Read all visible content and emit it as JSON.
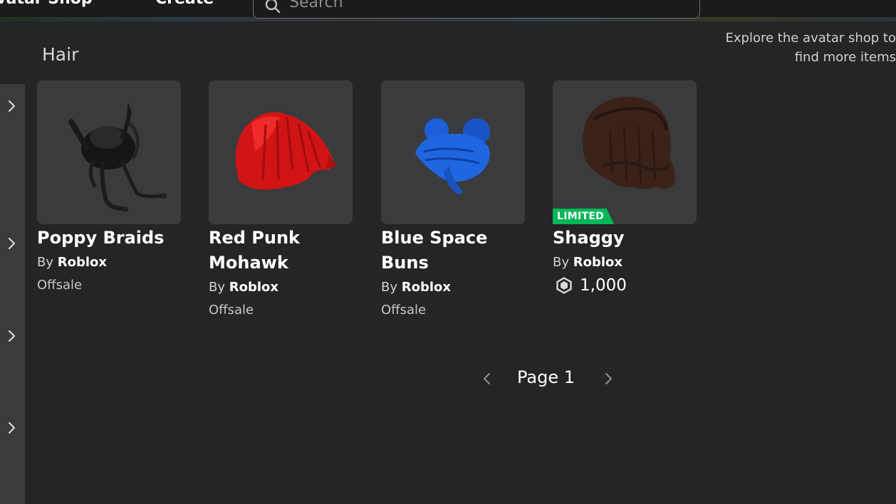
{
  "nav": {
    "avatar_shop": "Avatar Shop",
    "create": "Create",
    "search_placeholder": "Search"
  },
  "section": {
    "title": "Hair",
    "explore_line1": "Explore the avatar shop to",
    "explore_line2": "find more items"
  },
  "items": [
    {
      "name": "Poppy Braids",
      "by": "By",
      "creator": "Roblox",
      "status": "Offsale",
      "limited": false
    },
    {
      "name": "Red Punk Mohawk",
      "by": "By",
      "creator": "Roblox",
      "status": "Offsale",
      "limited": false
    },
    {
      "name": "Blue Space Buns",
      "by": "By",
      "creator": "Roblox",
      "status": "Offsale",
      "limited": false
    },
    {
      "name": "Shaggy",
      "by": "By",
      "creator": "Roblox",
      "price": "1,000",
      "limited": true,
      "badge": "LIMITED"
    }
  ],
  "pager": {
    "label": "Page 1"
  },
  "colors": {
    "background": "#232527",
    "card": "#393b3d",
    "limited_badge": "#02b757"
  },
  "icons": [
    "search-icon",
    "chevron-right-icon",
    "chevron-left-icon",
    "robux-icon"
  ]
}
